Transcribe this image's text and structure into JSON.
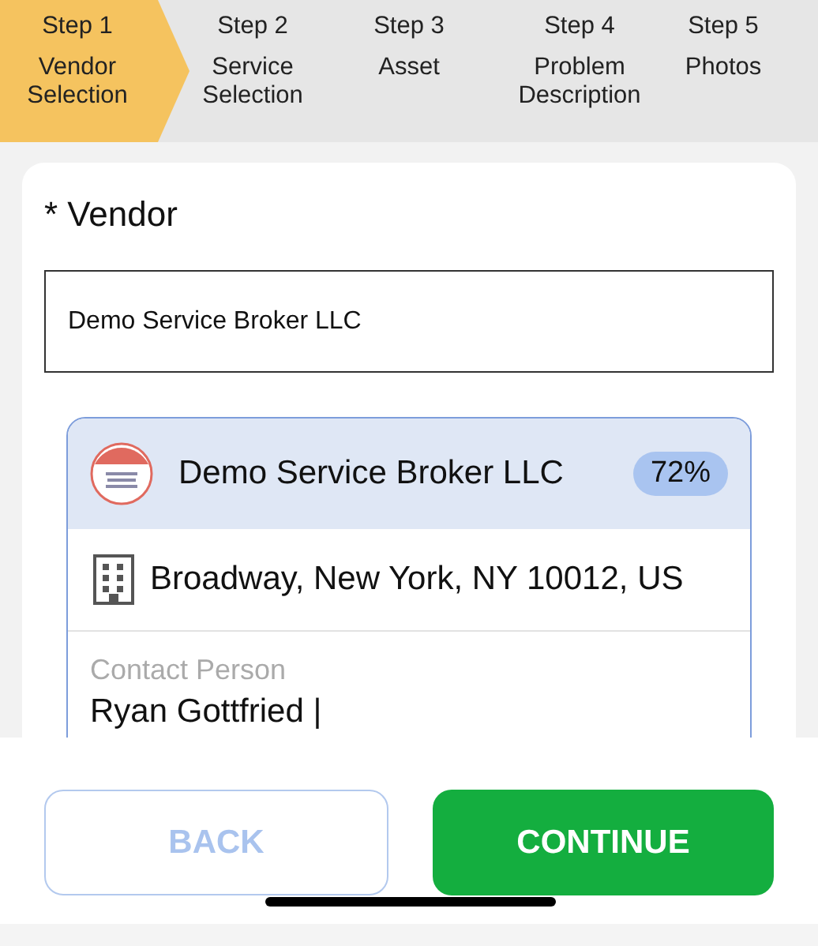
{
  "steps": [
    {
      "step": "Step 1",
      "label": "Vendor Selection",
      "selected": true
    },
    {
      "step": "Step 2",
      "label": "Service Selection",
      "selected": false
    },
    {
      "step": "Step 3",
      "label": "Asset",
      "selected": false
    },
    {
      "step": "Step 4",
      "label": "Problem Description",
      "selected": false
    },
    {
      "step": "Step 5",
      "label": "Photos",
      "selected": false
    }
  ],
  "vendor_field": {
    "label": "* Vendor",
    "value": "Demo Service Broker LLC"
  },
  "vendor_card": {
    "name": "Demo Service Broker LLC",
    "match": "72%",
    "address": "Broadway, New York, NY 10012, US",
    "contact_label": "Contact Person",
    "contact_value": "Ryan Gottfried |"
  },
  "buttons": [
    {
      "label": "BACK",
      "kind": "secondary"
    },
    {
      "label": "CONTINUE",
      "kind": "primary"
    }
  ]
}
